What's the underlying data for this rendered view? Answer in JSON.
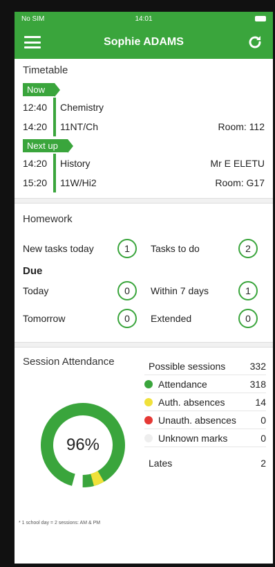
{
  "status_bar": {
    "carrier": "No SIM",
    "time": "14:01"
  },
  "app_bar": {
    "title": "Sophie ADAMS"
  },
  "timetable": {
    "title": "Timetable",
    "now": {
      "tag": "Now",
      "start": "12:40",
      "end": "14:20",
      "subject": "Chemistry",
      "group": "11NT/Ch",
      "teacher": "",
      "room": "Room: 112"
    },
    "next": {
      "tag": "Next up",
      "start": "14:20",
      "end": "15:20",
      "subject": "History",
      "group": "11W/Hi2",
      "teacher": "Mr E ELETU",
      "room": "Room: G17"
    }
  },
  "homework": {
    "title": "Homework",
    "new_tasks_label": "New tasks today",
    "new_tasks_value": "1",
    "tasks_to_do_label": "Tasks to do",
    "tasks_to_do_value": "2",
    "due_title": "Due",
    "today_label": "Today",
    "today_value": "0",
    "within7_label": "Within 7 days",
    "within7_value": "1",
    "tomorrow_label": "Tomorrow",
    "tomorrow_value": "0",
    "extended_label": "Extended",
    "extended_value": "0"
  },
  "attendance": {
    "title": "Session Attendance",
    "percent_text": "96%",
    "possible_label": "Possible sessions",
    "possible_value": "332",
    "items": [
      {
        "label": "Attendance",
        "value": "318",
        "color": "#3aa53c"
      },
      {
        "label": "Auth. absences",
        "value": "14",
        "color": "#f0e13a"
      },
      {
        "label": "Unauth. absences",
        "value": "0",
        "color": "#e53935"
      },
      {
        "label": "Unknown marks",
        "value": "0",
        "color": "#eeeeee"
      }
    ],
    "lates_label": "Lates",
    "lates_value": "2",
    "footnote": "* 1 school day = 2 sessions: AM & PM"
  },
  "colors": {
    "brand_green": "#3aa53c"
  }
}
